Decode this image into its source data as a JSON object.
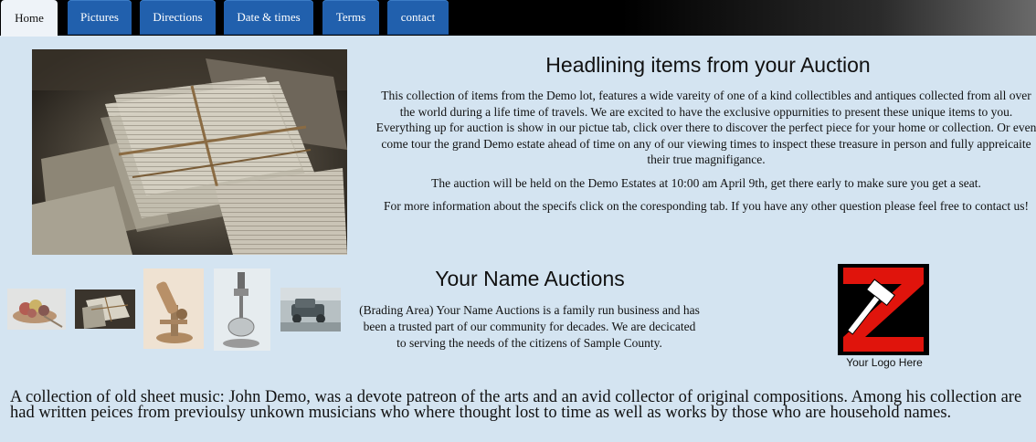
{
  "nav": {
    "tabs": [
      {
        "label": "Home",
        "active": true
      },
      {
        "label": "Pictures"
      },
      {
        "label": "Directions"
      },
      {
        "label": "Date & times"
      },
      {
        "label": "Terms"
      },
      {
        "label": "contact"
      }
    ]
  },
  "main": {
    "headline": "Headlining items from your Auction",
    "paragraphs": [
      "This collection of items from the Demo lot, features a wide vareity of one of a kind collectibles and antiques collected from all over the world during a life time of travels. We are excited to have the exclusive oppurnities to present these unique items to you. Everything up for auction is show in our pictue tab, click over there to discover the perfect piece for your home or collection. Or even come tour the grand Demo estate ahead of time on any of our viewing times to inspect these treasure in person and fully appreicaite their true magnifigance.",
      "The auction will be held on the Demo Estates at 10:00 am April 9th, get there early to make sure you get a seat.",
      "For more information about the specifs click on the coresponding tab. If you have any other question please feel free to contact us!"
    ]
  },
  "branding": {
    "name_title": "Your Name Auctions",
    "description": "(Brading Area) Your Name Auctions is a family run business and has been a trusted part of our community for decades. We are decicated to serving the needs of the citizens of Sample County.",
    "logo_caption": "Your Logo Here"
  },
  "gallery": {
    "thumbnails": [
      "fruit-bowl-thumbnail",
      "sheet-music-thumbnail",
      "microscope-thumbnail",
      "scientific-instrument-thumbnail",
      "vintage-car-thumbnail"
    ]
  },
  "caption": "A collection of old sheet music: John Demo, was a devote patreon of the arts and an avid collector of original compositions. Among his collection are had written peices from previoulsy unkown musicians who where thought lost to time as well as works by those who are household names.",
  "colors": {
    "page_bg": "#d4e4f1",
    "tab_bg": "#2160ad",
    "tab_active_bg": "#eef3f8",
    "logo_red": "#e0140c"
  }
}
